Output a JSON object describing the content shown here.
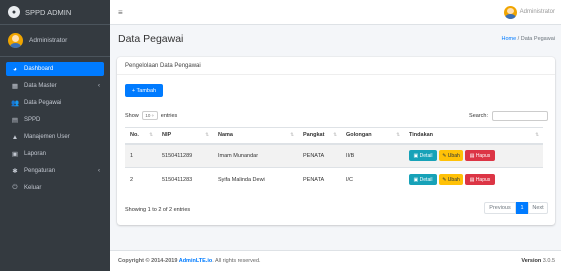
{
  "brand": {
    "logo_glyph": "●",
    "title": "SPPD ADMIN"
  },
  "sidebar": {
    "user_name": "Administrator",
    "items": [
      {
        "icon": "tachometer-icon",
        "glyph": "◕",
        "label": "Dashboard",
        "active": true,
        "caret": ""
      },
      {
        "icon": "table-icon",
        "glyph": "▦",
        "label": "Data Master",
        "active": false,
        "caret": "‹"
      },
      {
        "icon": "users-icon",
        "glyph": "👥",
        "label": "Data Pegawai",
        "active": false,
        "caret": ""
      },
      {
        "icon": "file-icon",
        "glyph": "▤",
        "label": "SPPD",
        "active": false,
        "caret": ""
      },
      {
        "icon": "user-icon",
        "glyph": "▲",
        "label": "Manajemen User",
        "active": false,
        "caret": ""
      },
      {
        "icon": "print-icon",
        "glyph": "▣",
        "label": "Laporan",
        "active": false,
        "caret": ""
      },
      {
        "icon": "cog-icon",
        "glyph": "✱",
        "label": "Pengaturan",
        "active": false,
        "caret": "‹"
      },
      {
        "icon": "power-icon",
        "glyph": "⏻",
        "label": "Keluar",
        "active": false,
        "caret": ""
      }
    ]
  },
  "topbar": {
    "menu_glyph": "≡",
    "user_name": "Administrator"
  },
  "header": {
    "title": "Data Pegawai",
    "breadcrumb_home": "Home",
    "breadcrumb_sep": " / ",
    "breadcrumb_current": "Data Pegawai"
  },
  "card": {
    "title": "Pengelolaan Data Pengawai",
    "add_label": "+ Tambah",
    "show_label": "Show",
    "entries_value": "10 ÷",
    "entries_label": "entries",
    "search_label": "Search:",
    "search_value": "",
    "columns": [
      "No.",
      "NIP",
      "Nama",
      "Pangkat",
      "Golongan",
      "Tindakan"
    ],
    "sort_glyph": "⇅",
    "rows": [
      {
        "no": "1",
        "nip": "5150411289",
        "nama": "Imam Munandar",
        "pangkat": "PENATA",
        "golongan": "II/B"
      },
      {
        "no": "2",
        "nip": "5150411283",
        "nama": "Syifa Malinda Dewi",
        "pangkat": "PENATA",
        "golongan": "I/C"
      }
    ],
    "btn_detail": "▣ Detail",
    "btn_ubah": "✎ Ubah",
    "btn_hapus": "▤ Hapus",
    "info": "Showing 1 to 2 of 2 entries",
    "pager": {
      "prev": "Previous",
      "current": "1",
      "next": "Next"
    }
  },
  "footer": {
    "copy": "Copyright © 2014-2019 ",
    "link": "AdminLTE.io",
    "rights": ". All rights reserved.",
    "version_label": "Version",
    "version_value": "3.0.5"
  },
  "colors": {
    "primary": "#007bff",
    "sidebar_bg": "#343a40",
    "info": "#17a2b8",
    "warning": "#ffc107",
    "danger": "#dc3545"
  }
}
